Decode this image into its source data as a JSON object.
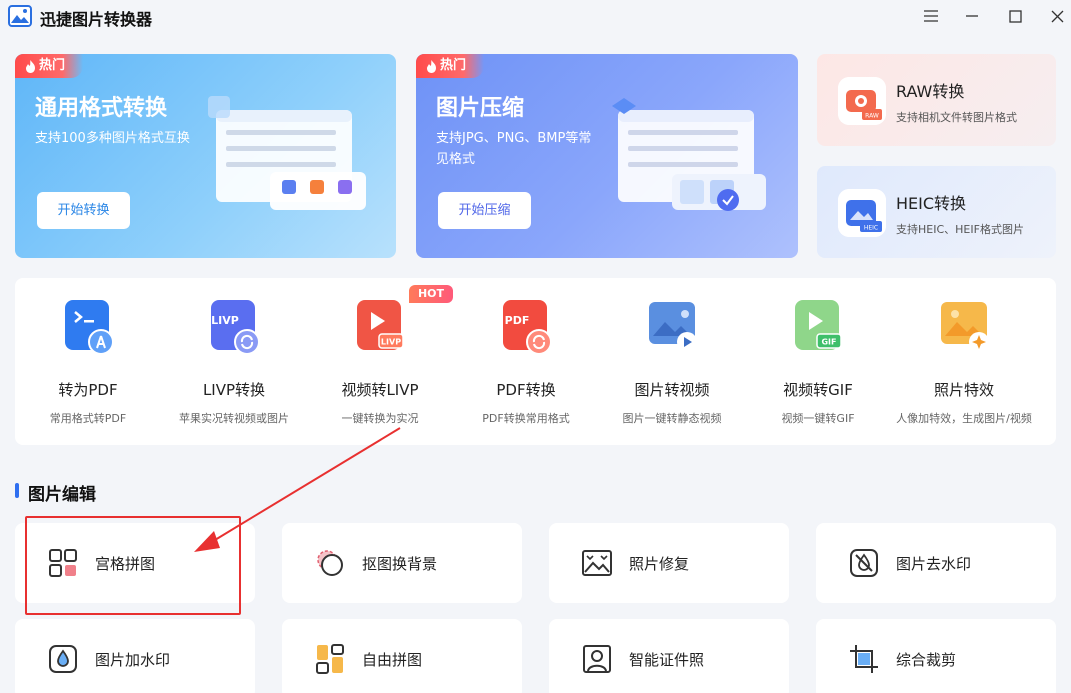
{
  "app": {
    "title": "迅捷图片转换器"
  },
  "hero": [
    {
      "tag": "热门",
      "title": "通用格式转换",
      "desc": "支持100多种图片格式互换",
      "button": "开始转换"
    },
    {
      "tag": "热门",
      "title": "图片压缩",
      "desc": "支持JPG、PNG、BMP等常见格式",
      "button": "开始压缩"
    }
  ],
  "side": [
    {
      "title": "RAW转换",
      "sub": "支持相机文件转图片格式",
      "badge": "RAW"
    },
    {
      "title": "HEIC转换",
      "sub": "支持HEIC、HEIF格式图片",
      "badge": "HEIC"
    }
  ],
  "tools": [
    {
      "title": "转为PDF",
      "sub": "常用格式转PDF"
    },
    {
      "title": "LIVP转换",
      "sub": "苹果实况转视频或图片",
      "icon_text": "LIVP"
    },
    {
      "title": "视频转LIVP",
      "sub": "一键转换为实况",
      "badge": "HOT",
      "icon_text": "LIVP"
    },
    {
      "title": "PDF转换",
      "sub": "PDF转换常用格式",
      "icon_text": "PDF"
    },
    {
      "title": "图片转视频",
      "sub": "图片一键转静态视频"
    },
    {
      "title": "视频转GIF",
      "sub": "视频一键转GIF",
      "icon_text": "GIF"
    },
    {
      "title": "照片特效",
      "sub": "人像加特效，生成图片/视频"
    }
  ],
  "section": {
    "title": "图片编辑"
  },
  "edit": [
    {
      "label": "宫格拼图"
    },
    {
      "label": "抠图换背景"
    },
    {
      "label": "照片修复"
    },
    {
      "label": "图片去水印"
    },
    {
      "label": "图片加水印"
    },
    {
      "label": "自由拼图"
    },
    {
      "label": "智能证件照"
    },
    {
      "label": "综合裁剪"
    }
  ],
  "colors": {
    "accent": "#2f6ff0",
    "hot": "#ff4b4b",
    "highlight": "#e83030"
  }
}
